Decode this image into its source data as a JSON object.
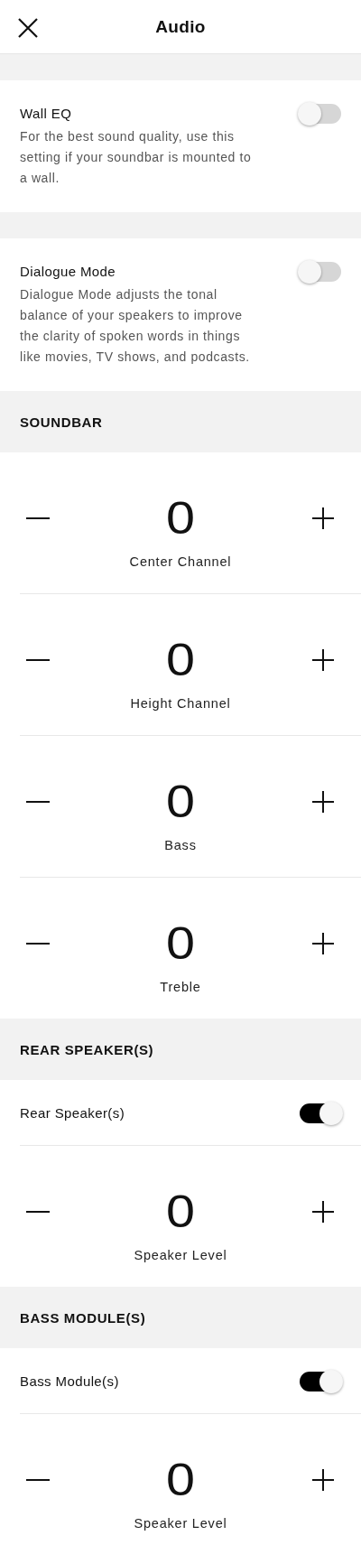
{
  "header": {
    "title": "Audio"
  },
  "groups": [
    {
      "items": [
        {
          "kind": "toggle",
          "label": "Wall EQ",
          "description": "For the best sound quality, use this setting if your soundbar is mounted to a wall.",
          "on": false
        }
      ]
    },
    {
      "items": [
        {
          "kind": "toggle",
          "label": "Dialogue Mode",
          "description": "Dialogue Mode adjusts the tonal balance of your speakers to improve the clarity of spoken words in things like movies, TV shows, and podcasts.",
          "on": false
        }
      ]
    },
    {
      "heading": "SOUNDBAR",
      "items": [
        {
          "kind": "stepper",
          "value": "0",
          "label": "Center Channel"
        },
        {
          "kind": "stepper",
          "value": "0",
          "label": "Height Channel"
        },
        {
          "kind": "stepper",
          "value": "0",
          "label": "Bass"
        },
        {
          "kind": "stepper",
          "value": "0",
          "label": "Treble"
        }
      ]
    },
    {
      "heading": "REAR SPEAKER(S)",
      "items": [
        {
          "kind": "toggle",
          "label": "Rear Speaker(s)",
          "on": true
        },
        {
          "kind": "stepper",
          "value": "0",
          "label": "Speaker Level"
        }
      ]
    },
    {
      "heading": "BASS MODULE(S)",
      "items": [
        {
          "kind": "toggle",
          "label": "Bass Module(s)",
          "on": true
        },
        {
          "kind": "stepper",
          "value": "0",
          "label": "Speaker Level"
        }
      ]
    }
  ]
}
